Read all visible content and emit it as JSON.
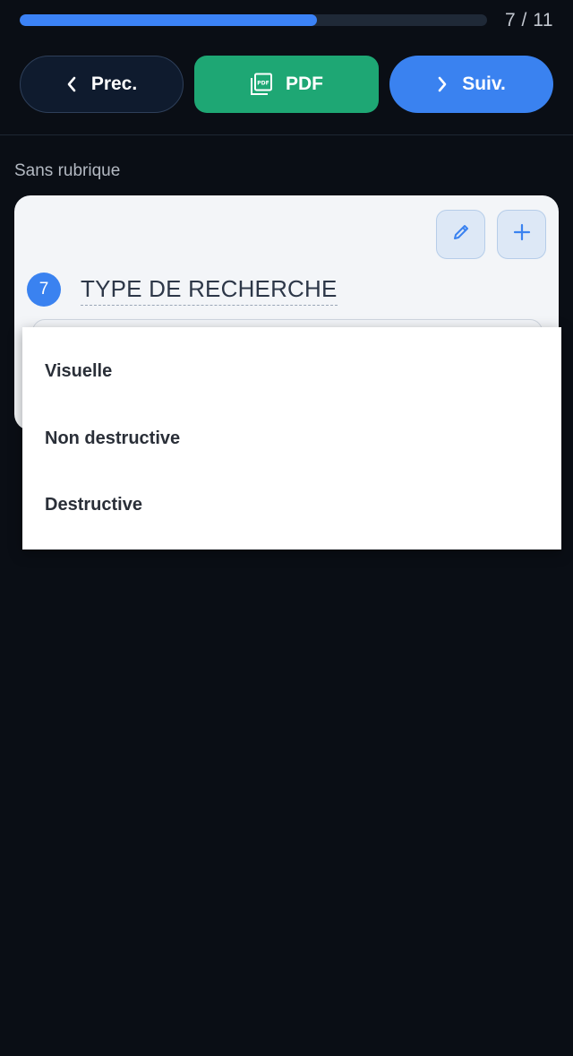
{
  "progress": {
    "current": 7,
    "total": 11,
    "counter_text": "7 / 11",
    "fraction": 0.636
  },
  "nav": {
    "prev_label": "Prec.",
    "pdf_label": "PDF",
    "next_label": "Suiv.",
    "prev_icon": "chevron-left-icon",
    "pdf_icon": "pdf-file-icon",
    "next_icon": "chevron-right-icon"
  },
  "section": {
    "label": "Sans rubrique"
  },
  "question": {
    "number": "7",
    "title": "TYPE DE RECHERCHE",
    "edit_icon": "pencil-icon",
    "add_icon": "plus-icon"
  },
  "dropdown": {
    "options": [
      "Visuelle",
      "Non destructive",
      "Destructive"
    ]
  },
  "colors": {
    "background": "#0a0e15",
    "accent_blue": "#3a82f0",
    "pdf_green": "#1ea774",
    "card": "#f3f5f8"
  }
}
